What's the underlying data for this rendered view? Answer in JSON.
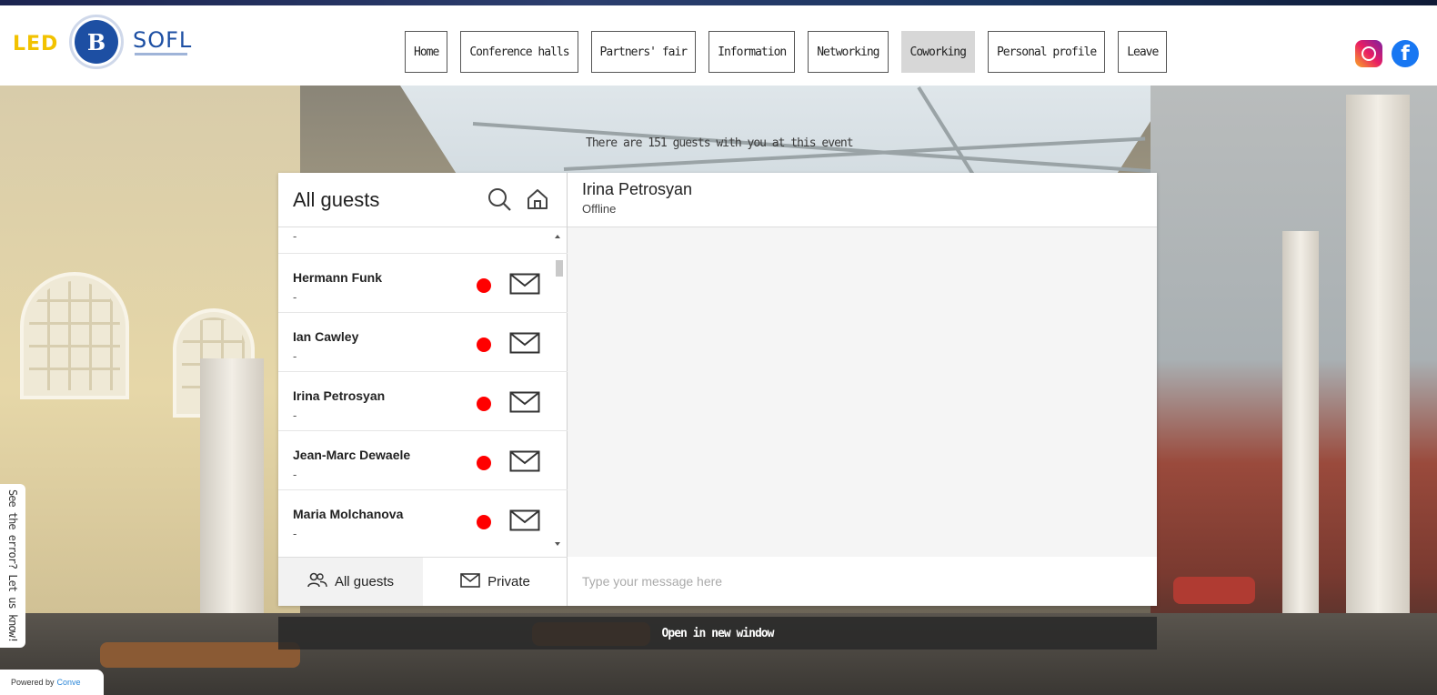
{
  "header": {
    "logo_led": "LED",
    "logo_hse": "B",
    "logo_sofl": "SOFL",
    "nav": [
      {
        "label": "Home",
        "active": false
      },
      {
        "label": "Conference halls",
        "active": false
      },
      {
        "label": "Partners' fair",
        "active": false
      },
      {
        "label": "Information",
        "active": false
      },
      {
        "label": "Networking",
        "active": false
      },
      {
        "label": "Coworking",
        "active": true
      },
      {
        "label": "Personal profile",
        "active": false
      },
      {
        "label": "Leave",
        "active": false
      }
    ],
    "social": [
      "instagram-icon",
      "facebook-icon"
    ],
    "facebook_glyph": "f"
  },
  "guests_info": "There are 151 guests with you at this event",
  "chat": {
    "left_title": "All guests",
    "partial_row_sub": "-",
    "guests": [
      {
        "name": "Hermann Funk",
        "sub": "-"
      },
      {
        "name": "Ian Cawley",
        "sub": "-"
      },
      {
        "name": "Irina Petrosyan",
        "sub": "-"
      },
      {
        "name": "Jean-Marc Dewaele",
        "sub": "-"
      },
      {
        "name": "Maria Molchanova",
        "sub": "-"
      }
    ],
    "tabs": {
      "all": "All guests",
      "private": "Private"
    },
    "selected": {
      "name": "Irina Petrosyan",
      "status": "Offline"
    },
    "input_placeholder": "Type your message here"
  },
  "open_new_window": "Open in new window",
  "error_report": "See the error? Let us know!",
  "powered_by": {
    "prefix": "Powered by",
    "brand": "Conve"
  },
  "colors": {
    "status_dot": "#ff0000",
    "active_nav": "#d7d7d7",
    "brand_blue": "#1d4fa3",
    "led_yellow": "#f2c200"
  }
}
